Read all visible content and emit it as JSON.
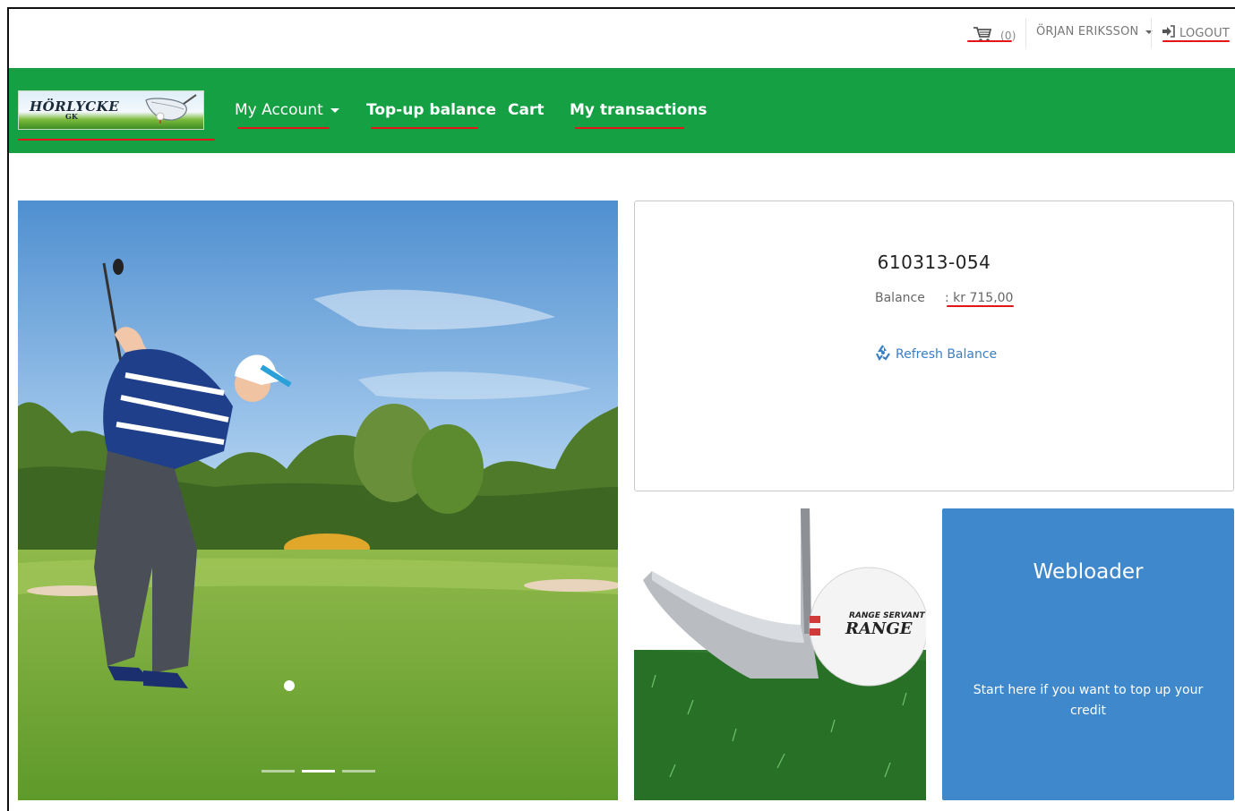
{
  "topbar": {
    "cart_count": "(0)",
    "user_name": "ÖRJAN ERIKSSON",
    "logout_label": "LOGOUT"
  },
  "nav": {
    "logo_text": "HÖRLYCKE",
    "logo_sub": "GK",
    "items": [
      {
        "label": "My Account"
      },
      {
        "label": "Top-up balance"
      },
      {
        "label": "Cart"
      },
      {
        "label": "My transactions"
      }
    ]
  },
  "balance_card": {
    "account_id": "610313-054",
    "balance_label": "Balance",
    "balance_value": ": kr 715,00",
    "refresh_label": "Refresh Balance"
  },
  "range_image": {
    "ball_brand": "RANGE SERVANT",
    "ball_text": "RANGE"
  },
  "webloader": {
    "title": "Webloader",
    "text": "Start here if you want to top up your credit"
  },
  "carousel": {
    "slides": 3,
    "active_slide": 2
  },
  "colors": {
    "navbar": "#14a043",
    "tile": "#3f88cc",
    "link": "#3a7fc4",
    "annotation": "#e3141a"
  },
  "icons": [
    "cart-icon",
    "caret-down-icon",
    "logout-icon",
    "recycle-icon"
  ]
}
